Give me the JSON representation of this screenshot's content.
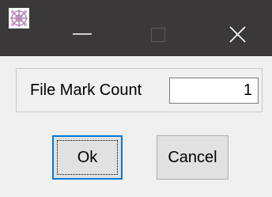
{
  "window": {
    "app_icon": "celtic-knot-icon",
    "controls": [
      "minimize-icon",
      "maximize-icon",
      "close-icon"
    ]
  },
  "form": {
    "label": "File Mark Count",
    "value": "1"
  },
  "buttons": {
    "ok": "Ok",
    "cancel": "Cancel"
  },
  "colors": {
    "titlebar": "#3a3838",
    "background": "#f0f0f0",
    "focus_border": "#0078d7"
  }
}
